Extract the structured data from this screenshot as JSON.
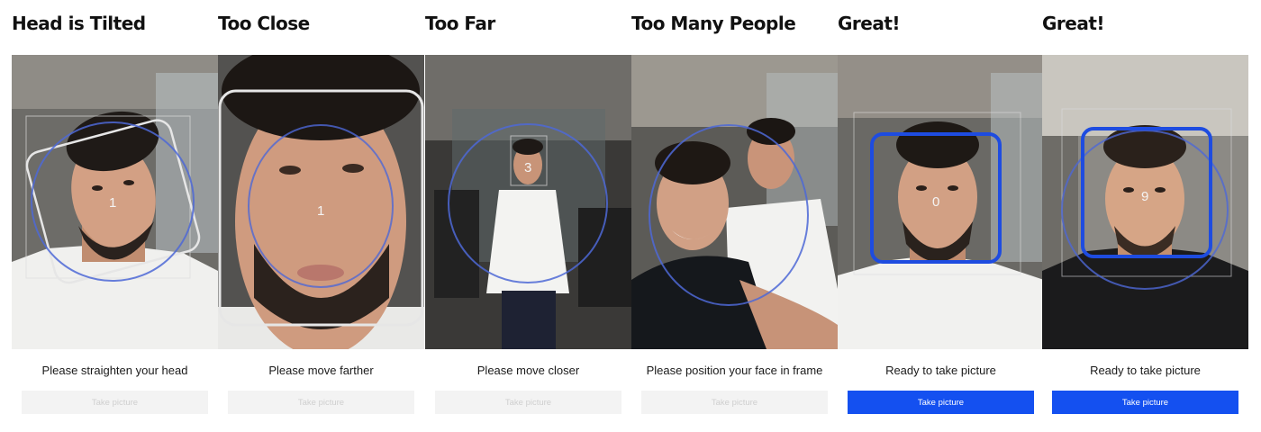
{
  "panels": [
    {
      "title": "Head is Tilted",
      "countdown": "1",
      "message": "Please straighten your head",
      "button_label": "Take picture",
      "button_enabled": false
    },
    {
      "title": "Too Close",
      "countdown": "1",
      "message": "Please move farther",
      "button_label": "Take picture",
      "button_enabled": false
    },
    {
      "title": "Too Far",
      "countdown": "3",
      "message": "Please move closer",
      "button_label": "Take picture",
      "button_enabled": false
    },
    {
      "title": "Too Many People",
      "countdown": "",
      "message": "Please position your face in frame",
      "button_label": "Take picture",
      "button_enabled": false
    },
    {
      "title": "Great!",
      "countdown": "0",
      "message": "Ready to take picture",
      "button_label": "Take picture",
      "button_enabled": true
    },
    {
      "title": "Great!",
      "countdown": "9",
      "message": "Ready to take picture",
      "button_label": "Take picture",
      "button_enabled": true
    }
  ],
  "colors": {
    "guide_oval": "#4d68d6",
    "face_box_ok": "#1e4ce0",
    "face_box_bad": "#e6e6e6",
    "button_enabled": "#1450f0",
    "button_disabled": "#f3f3f3"
  }
}
